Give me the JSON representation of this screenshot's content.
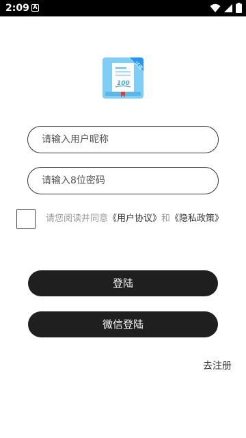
{
  "status_bar": {
    "time": "2:09",
    "notification_glyph": "A",
    "icons": [
      "wifi-icon",
      "signal-icon",
      "battery-icon"
    ]
  },
  "app_logo": {
    "badge_text": "试卷",
    "paper_text": "100",
    "colors": {
      "background": "#7fcef5",
      "paper": "#ffffff",
      "badge": "#2196f3"
    }
  },
  "form": {
    "nickname_placeholder": "请输入用户昵称",
    "password_placeholder": "请输入8位密码"
  },
  "agreement": {
    "prefix": "请您阅读并同意",
    "user_agreement": "《用户协议》",
    "connector": "和",
    "privacy_policy": "《隐私政策》"
  },
  "buttons": {
    "login": "登陆",
    "wechat_login": "微信登陆"
  },
  "register_link": "去注册",
  "colors": {
    "button_bg": "#1f1f1f",
    "hint_text": "#999999"
  }
}
